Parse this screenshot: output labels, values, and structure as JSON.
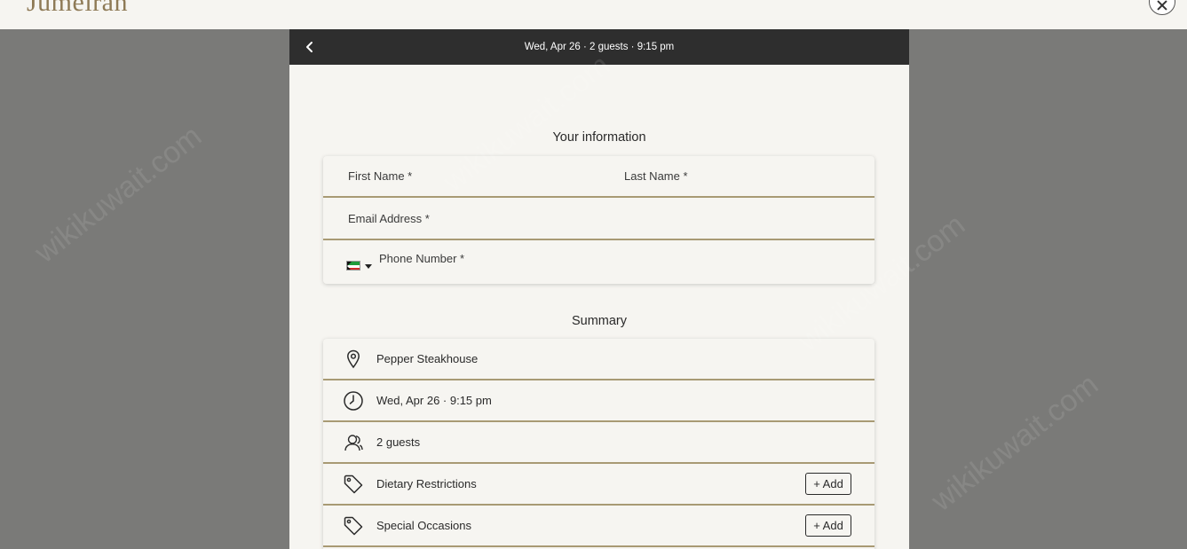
{
  "brand": {
    "name": "Jumeirah"
  },
  "header": {
    "summary": "Wed, Apr 26  ·  2 guests  ·  9:15 pm"
  },
  "your_information": {
    "title": "Your information",
    "first_name_label": "First Name *",
    "last_name_label": "Last Name *",
    "email_label": "Email Address *",
    "phone_label": "Phone Number *"
  },
  "summary": {
    "title": "Summary",
    "restaurant": "Pepper Steakhouse",
    "datetime": "Wed, Apr 26  ·  9:15 pm",
    "guests": "2 guests",
    "dietary_label": "Dietary Restrictions",
    "occasion_label": "Special Occasions",
    "add_label": "+ Add"
  },
  "watermark": "wikikuwait.com",
  "colors": {
    "accent": "#a89a74",
    "header_bg": "#2e2e2e",
    "panel_bg": "#f6f5f1",
    "overlay": "#7a7a78",
    "brand": "#8e7a56"
  },
  "icons": {
    "back": "chevron-left-icon",
    "close": "close-icon",
    "location": "map-pin-icon",
    "time": "clock-icon",
    "guests": "users-icon",
    "tag": "tag-icon",
    "flag": "kuwait-flag-icon"
  }
}
